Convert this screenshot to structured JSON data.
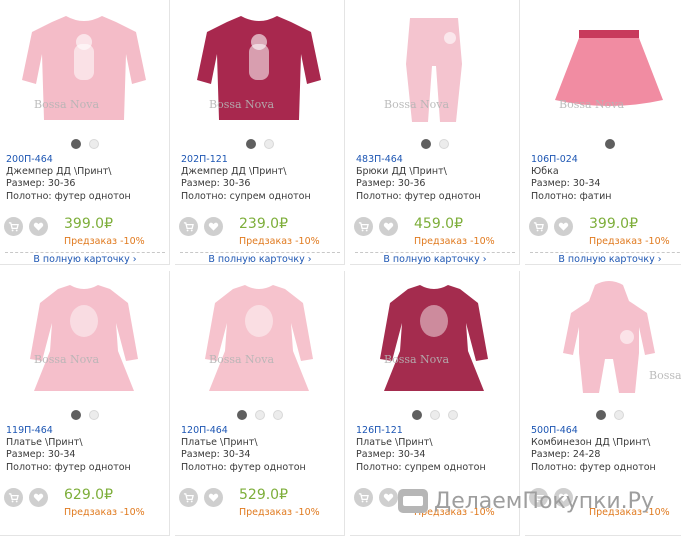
{
  "products": [
    {
      "sku": "200П-464",
      "name": "Джемпер ДД \\Принт\\",
      "size": "Размер: 30-36",
      "fabric": "Полотно: футер однотон",
      "price": "399.0₽",
      "preorder": "Предзаказ -10%",
      "link": "В полную карточку ›",
      "dots": 2,
      "active": 0,
      "item": "sweater",
      "color": "#f4bcc8",
      "logo": true
    },
    {
      "sku": "202П-121",
      "name": "Джемпер ДД \\Принт\\",
      "size": "Размер: 30-36",
      "fabric": "Полотно: супрем однотон",
      "price": "239.0₽",
      "preorder": "Предзаказ -10%",
      "link": "В полную карточку ›",
      "dots": 2,
      "active": 0,
      "item": "sweater",
      "color": "#a8284e",
      "logo": true
    },
    {
      "sku": "483П-464",
      "name": "Брюки ДД \\Принт\\",
      "size": "Размер: 30-36",
      "fabric": "Полотно: футер однотон",
      "price": "459.0₽",
      "preorder": "Предзаказ -10%",
      "link": "В полную карточку ›",
      "dots": 2,
      "active": 0,
      "item": "pants",
      "color": "#f4c4cf",
      "logo": true
    },
    {
      "sku": "106П-024",
      "name": "Юбка",
      "size": "Размер: 30-34",
      "fabric": "Полотно: фатин",
      "price": "399.0₽",
      "preorder": "Предзаказ -10%",
      "link": "В полную карточку ›",
      "dots": 1,
      "active": 0,
      "item": "skirt",
      "color": "#ef7f98",
      "logo": true
    },
    {
      "sku": "119П-464",
      "name": "Платье \\Принт\\",
      "size": "Размер: 30-34",
      "fabric": "Полотно: футер однотон",
      "price": "629.0₽",
      "preorder": "Предзаказ -10%",
      "link": "",
      "dots": 2,
      "active": 0,
      "item": "dress",
      "color": "#f5bfcb",
      "logo": true
    },
    {
      "sku": "120П-464",
      "name": "Платье \\Принт\\",
      "size": "Размер: 30-34",
      "fabric": "Полотно: футер однотон",
      "price": "529.0₽",
      "preorder": "Предзаказ -10%",
      "link": "",
      "dots": 3,
      "active": 0,
      "item": "dress",
      "color": "#f6c3cd",
      "logo": true
    },
    {
      "sku": "126П-121",
      "name": "Платье \\Принт\\",
      "size": "Размер: 30-34",
      "fabric": "Полотно: супрем однотон",
      "price": "",
      "preorder": "Предзаказ -10%",
      "link": "",
      "dots": 3,
      "active": 0,
      "item": "dress",
      "color": "#a42c4e",
      "logo": true
    },
    {
      "sku": "500П-464",
      "name": "Комбинезон ДД \\Принт\\",
      "size": "Размер: 24-28",
      "fabric": "Полотно: футер однотон",
      "price": "",
      "preorder": "Предзаказ -10%",
      "link": "",
      "dots": 2,
      "active": 0,
      "item": "romper",
      "color": "#f5c0cc",
      "logo": true
    }
  ],
  "logo_text": "Bossa Nova",
  "watermark": {
    "text": "ДелаемПокупки.Ру"
  },
  "icons": {
    "cart": "cart-icon",
    "favorite": "heart-icon"
  }
}
